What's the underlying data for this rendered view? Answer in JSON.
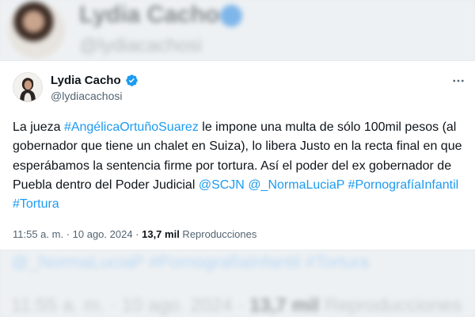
{
  "background": {
    "name": "Lydia Cacho",
    "handle": "@lydiacachosi",
    "tags_line": "@_NormaLuciaP #PornografíaInfantil #Tortura",
    "time": "11:55 a. m. · 10 ago. 2024 ·",
    "views_count": "13,7 mil",
    "views_label": "Reproducciones"
  },
  "tweet": {
    "author_name": "Lydia Cacho",
    "author_handle": "@lydiacachosi",
    "verified": true,
    "body": {
      "t1": "La jueza ",
      "h1": "#AngélicaOrtuñoSuarez",
      "t2": " le impone una multa de sólo 100mil pesos (al gobernador que tiene un chalet en Suiza), lo libera Justo en la recta final en que esperábamos la sentencia firme por tortura. Así el poder del ex gobernador de Puebla dentro del Poder Judicial ",
      "m1": "@SCJN",
      "sp1": " ",
      "m2": "@_NormaLuciaP",
      "sp2": " ",
      "h2": "#PornografíaInfantil",
      "sp3": " ",
      "h3": "#Tortura"
    },
    "time": "11:55 a. m.",
    "sep1": " · ",
    "date": "10 ago. 2024",
    "sep2": " · ",
    "views_count": "13,7 mil",
    "views_label": " Reproducciones"
  },
  "colors": {
    "link": "#1d9bf0",
    "text": "#0f1419",
    "secondary": "#536471",
    "verified": "#1d9bf0"
  },
  "icons": {
    "verified": "verified-badge-icon",
    "more": "more-horizontal-icon"
  }
}
